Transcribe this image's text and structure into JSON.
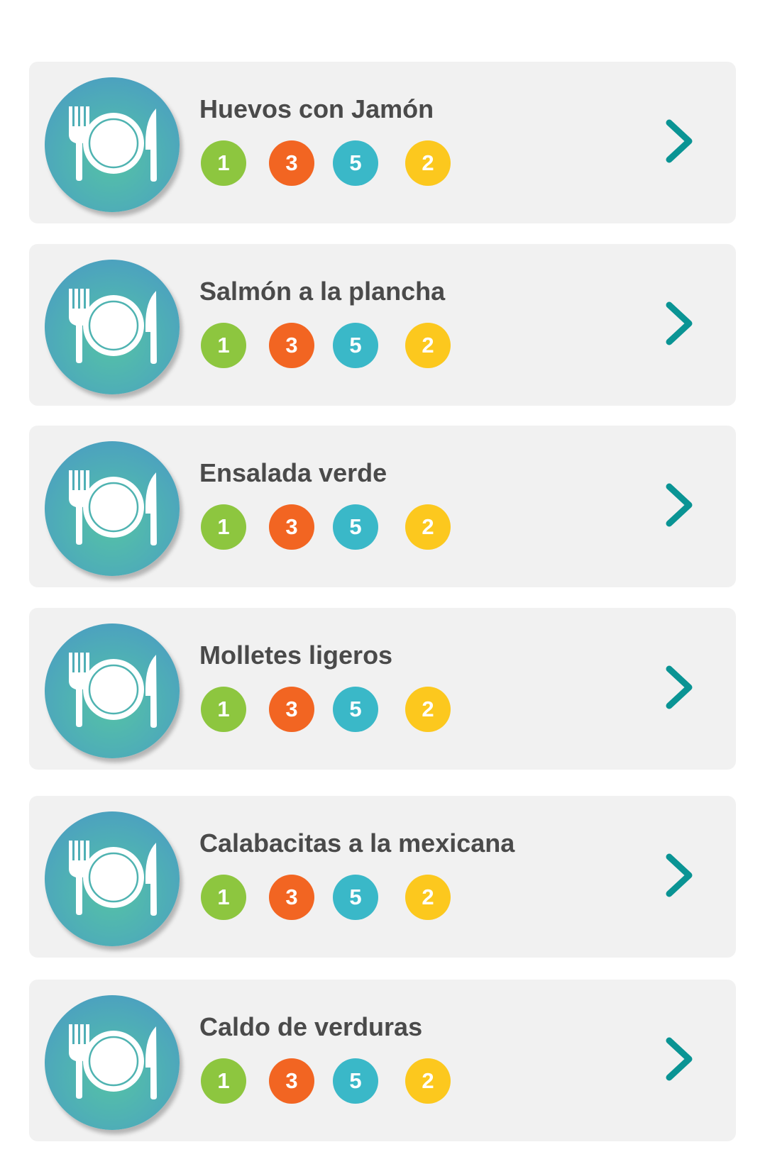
{
  "colors": {
    "card_bg": "#f1f1f1",
    "title": "#4a4a4a",
    "badge_green": "#8dc63f",
    "badge_orange": "#f26522",
    "badge_blue": "#3ab8c8",
    "badge_yellow": "#fcc81e",
    "chevron": "#0a9494"
  },
  "recipes": [
    {
      "title": "Huevos con Jamón",
      "icon": "plate-fork-knife-icon",
      "badges": [
        {
          "value": "1",
          "color": "#8dc63f"
        },
        {
          "value": "3",
          "color": "#f26522"
        },
        {
          "value": "5",
          "color": "#3ab8c8"
        },
        {
          "value": "2",
          "color": "#fcc81e"
        }
      ],
      "action_icon": "chevron-right-icon"
    },
    {
      "title": "Salmón a la plancha",
      "icon": "plate-fork-knife-icon",
      "badges": [
        {
          "value": "1",
          "color": "#8dc63f"
        },
        {
          "value": "3",
          "color": "#f26522"
        },
        {
          "value": "5",
          "color": "#3ab8c8"
        },
        {
          "value": "2",
          "color": "#fcc81e"
        }
      ],
      "action_icon": "chevron-right-icon"
    },
    {
      "title": "Ensalada verde",
      "icon": "plate-fork-knife-icon",
      "badges": [
        {
          "value": "1",
          "color": "#8dc63f"
        },
        {
          "value": "3",
          "color": "#f26522"
        },
        {
          "value": "5",
          "color": "#3ab8c8"
        },
        {
          "value": "2",
          "color": "#fcc81e"
        }
      ],
      "action_icon": "chevron-right-icon"
    },
    {
      "title": "Molletes ligeros",
      "icon": "plate-fork-knife-icon",
      "badges": [
        {
          "value": "1",
          "color": "#8dc63f"
        },
        {
          "value": "3",
          "color": "#f26522"
        },
        {
          "value": "5",
          "color": "#3ab8c8"
        },
        {
          "value": "2",
          "color": "#fcc81e"
        }
      ],
      "action_icon": "chevron-right-icon"
    },
    {
      "title": "Calabacitas a la mexicana",
      "icon": "plate-fork-knife-icon",
      "badges": [
        {
          "value": "1",
          "color": "#8dc63f"
        },
        {
          "value": "3",
          "color": "#f26522"
        },
        {
          "value": "5",
          "color": "#3ab8c8"
        },
        {
          "value": "2",
          "color": "#fcc81e"
        }
      ],
      "action_icon": "chevron-right-icon"
    },
    {
      "title": "Caldo de verduras",
      "icon": "plate-fork-knife-icon",
      "badges": [
        {
          "value": "1",
          "color": "#8dc63f"
        },
        {
          "value": "3",
          "color": "#f26522"
        },
        {
          "value": "5",
          "color": "#3ab8c8"
        },
        {
          "value": "2",
          "color": "#fcc81e"
        }
      ],
      "action_icon": "chevron-right-icon"
    }
  ]
}
